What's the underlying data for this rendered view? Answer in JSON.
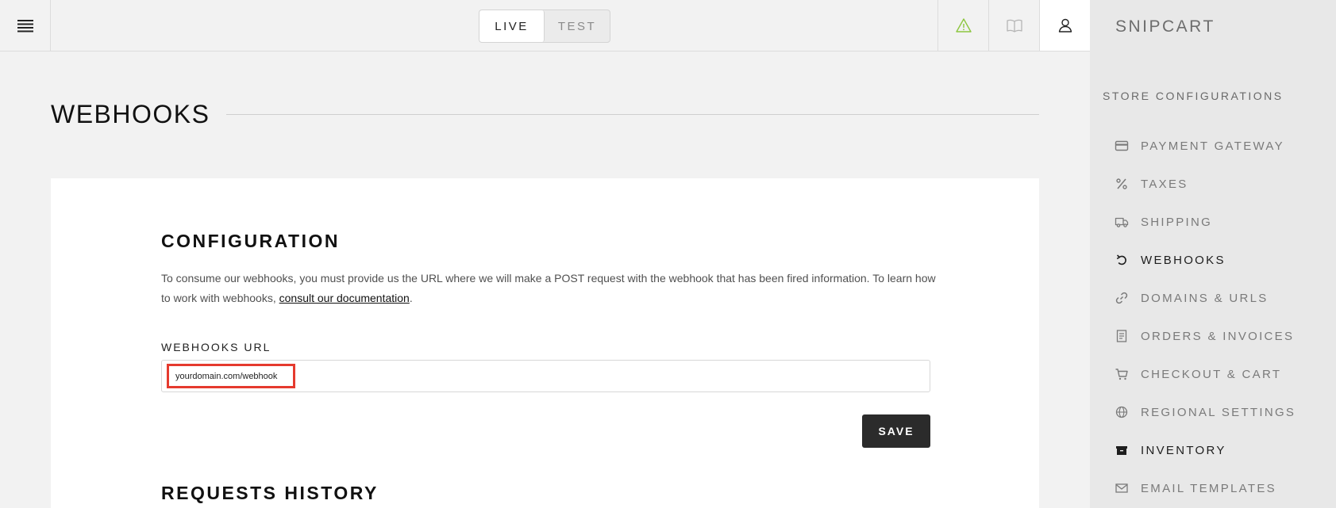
{
  "topbar": {
    "env": {
      "live_label": "LIVE",
      "test_label": "TEST",
      "selected": "LIVE"
    },
    "icons": [
      "menu-icon",
      "warning-icon",
      "book-icon",
      "user-icon"
    ]
  },
  "brand": "SNIPCART",
  "sidebar": {
    "heading": "STORE CONFIGURATIONS",
    "items": [
      {
        "label": "PAYMENT GATEWAY",
        "icon": "credit-card-icon",
        "active": false
      },
      {
        "label": "TAXES",
        "icon": "percent-icon",
        "active": false
      },
      {
        "label": "SHIPPING",
        "icon": "truck-icon",
        "active": false
      },
      {
        "label": "WEBHOOKS",
        "icon": "webhook-icon",
        "active": true
      },
      {
        "label": "DOMAINS & URLS",
        "icon": "link-icon",
        "active": false
      },
      {
        "label": "ORDERS & INVOICES",
        "icon": "invoice-icon",
        "active": false
      },
      {
        "label": "CHECKOUT & CART",
        "icon": "cart-icon",
        "active": false
      },
      {
        "label": "REGIONAL SETTINGS",
        "icon": "globe-icon",
        "active": false
      },
      {
        "label": "INVENTORY",
        "icon": "box-icon",
        "active": true
      },
      {
        "label": "EMAIL TEMPLATES",
        "icon": "envelope-icon",
        "active": false
      }
    ]
  },
  "main": {
    "page_title": "WEBHOOKS",
    "config": {
      "title": "CONFIGURATION",
      "description_before": "To consume our webhooks, you must provide us the URL where we will make a POST request with the webhook that has been fired information. To learn how to work with webhooks, ",
      "doc_link": "consult our documentation",
      "description_after": ".",
      "field_label": "WEBHOOKS URL",
      "url_value": "yourdomain.com/webhook",
      "save_label": "SAVE"
    },
    "history": {
      "title": "REQUESTS HISTORY"
    }
  },
  "colors": {
    "highlight": "#e53a2e",
    "warning": "#8cc63f",
    "button": "#2b2b2b"
  }
}
